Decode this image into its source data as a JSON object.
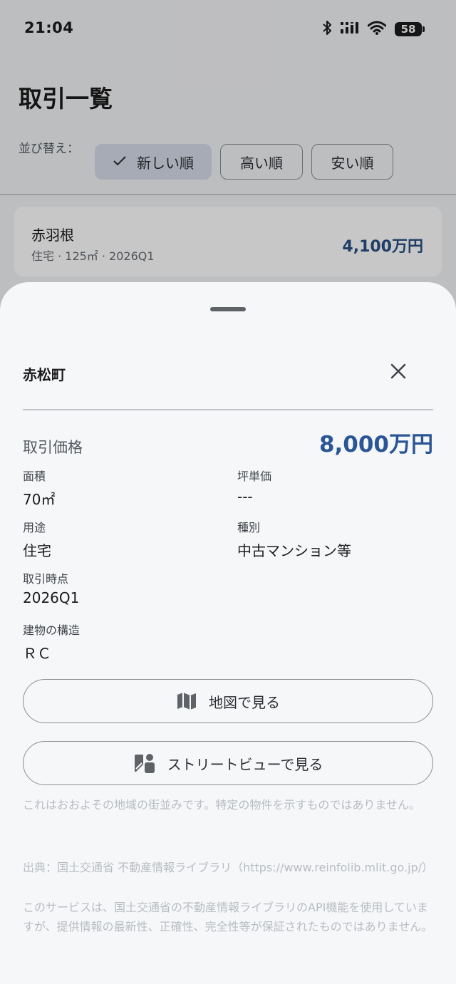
{
  "status_bar": {
    "time": "21:04",
    "battery": "58"
  },
  "page": {
    "title": "取引一覧",
    "sort": {
      "label": "並び替え：",
      "options": [
        "新しい順",
        "高い順",
        "安い順"
      ],
      "selected": "新しい順"
    },
    "list": [
      {
        "name": "赤羽根",
        "meta": "住宅 · 125㎡ · 2026Q1",
        "price": "4,100万円"
      }
    ]
  },
  "sheet": {
    "title": "赤松町",
    "price_label": "取引価格",
    "price_value": "8,000万円",
    "fields": {
      "area": {
        "label": "面積",
        "value": "70㎡"
      },
      "tsubo_price": {
        "label": "坪単価",
        "value": "---"
      },
      "use": {
        "label": "用途",
        "value": "住宅"
      },
      "type": {
        "label": "種別",
        "value": "中古マンション等"
      },
      "period": {
        "label": "取引時点",
        "value": "2026Q1"
      },
      "structure": {
        "label": "建物の構造",
        "value": "ＲＣ"
      }
    },
    "map_button": "地図で見る",
    "street_button": "ストリートビューで見る",
    "disclaimer": "これはおおよその地域の街並みです。特定の物件を示すものではありません。",
    "source": "出典：国土交通省 不動産情報ライブラリ（https://www.reinfolib.mlit.go.jp/）",
    "notice": "このサービスは、国土交通省の不動産情報ライブラリのAPI機能を使用していますが、提供情報の最新性、正確性、完全性等が保証されたものではありません。"
  },
  "colors": {
    "accent": "#2a5696",
    "sheet_bg": "#f6f7f9"
  },
  "icons": [
    "bluetooth-icon",
    "signal-icon",
    "wifi-icon",
    "battery-icon",
    "check-icon",
    "close-icon",
    "map-icon",
    "street-view-icon"
  ]
}
